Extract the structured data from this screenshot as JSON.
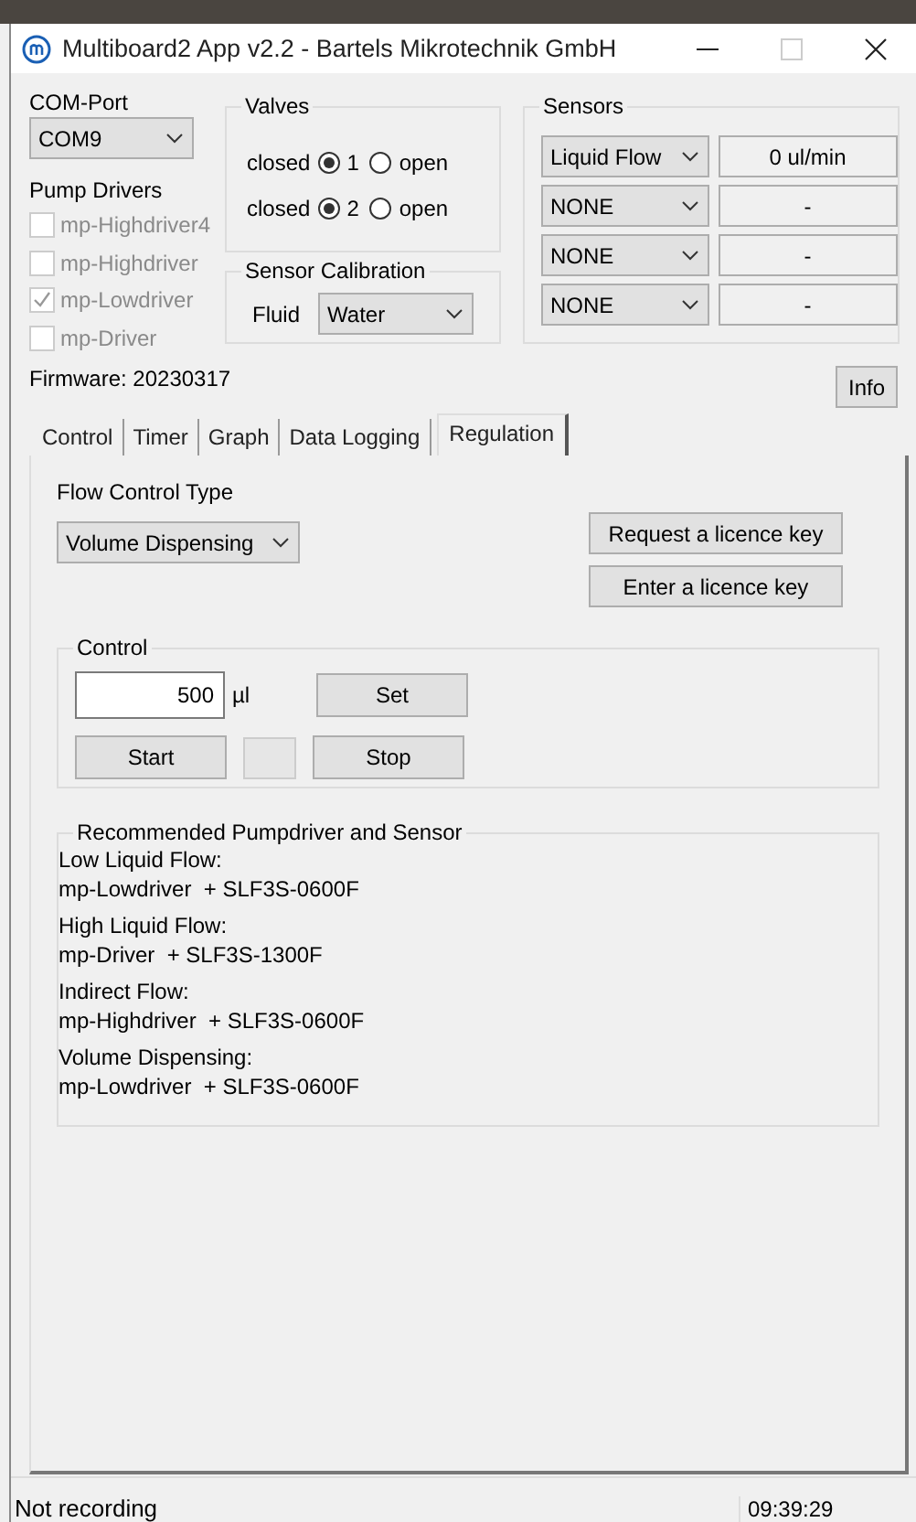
{
  "window": {
    "title": "Multiboard2 App v2.2 - Bartels Mikrotechnik GmbH"
  },
  "com_port": {
    "label": "COM-Port",
    "value": "COM9"
  },
  "pump_drivers": {
    "label": "Pump Drivers",
    "items": [
      {
        "label": "mp-Highdriver4",
        "checked": false,
        "disabled": true
      },
      {
        "label": "mp-Highdriver",
        "checked": false,
        "disabled": true
      },
      {
        "label": "mp-Lowdriver",
        "checked": true,
        "disabled": true
      },
      {
        "label": "mp-Driver",
        "checked": false,
        "disabled": true
      }
    ]
  },
  "valves": {
    "title": "Valves",
    "rows": [
      {
        "number": "1",
        "options": [
          {
            "label": "closed",
            "selected": true
          },
          {
            "label": "open",
            "selected": false
          }
        ]
      },
      {
        "number": "2",
        "options": [
          {
            "label": "closed",
            "selected": true
          },
          {
            "label": "open",
            "selected": false
          }
        ]
      }
    ]
  },
  "sensor_calibration": {
    "title": "Sensor Calibration",
    "fluid_label": "Fluid",
    "fluid": "Water"
  },
  "sensors": {
    "title": "Sensors",
    "rows": [
      {
        "type": "Liquid Flow",
        "reading": "0 ul/min"
      },
      {
        "type": "NONE",
        "reading": "-"
      },
      {
        "type": "NONE",
        "reading": "-"
      },
      {
        "type": "NONE",
        "reading": "-"
      }
    ]
  },
  "firmware": "Firmware: 20230317",
  "info_button": "Info",
  "tabs": [
    {
      "label": "Control",
      "selected": false
    },
    {
      "label": "Timer",
      "selected": false
    },
    {
      "label": "Graph",
      "selected": false
    },
    {
      "label": "Data Logging",
      "selected": false
    },
    {
      "label": "Regulation",
      "selected": true
    }
  ],
  "regulation": {
    "flow_control_type_label": "Flow Control Type",
    "flow_control_type": "Volume Dispensing",
    "licence_buttons": [
      "Request a licence key",
      "Enter a licence key"
    ],
    "control": {
      "title": "Control",
      "amount": "500",
      "unit": "µl",
      "set": "Set",
      "start": "Start",
      "stop": "Stop"
    },
    "recommended": {
      "title": "Recommended Pumpdriver and Sensor",
      "entries": [
        {
          "label": "Low Liquid Flow:",
          "value": "mp-Lowdriver  + SLF3S-0600F"
        },
        {
          "label": "High Liquid Flow:",
          "value": "mp-Driver  + SLF3S-1300F"
        },
        {
          "label": "Indirect Flow:",
          "value": "mp-Highdriver  + SLF3S-0600F"
        },
        {
          "label": "Volume Dispensing:",
          "value": "mp-Lowdriver  + SLF3S-0600F"
        }
      ]
    }
  },
  "status_bar": {
    "recording": "Not recording",
    "time": "09:39:29"
  }
}
